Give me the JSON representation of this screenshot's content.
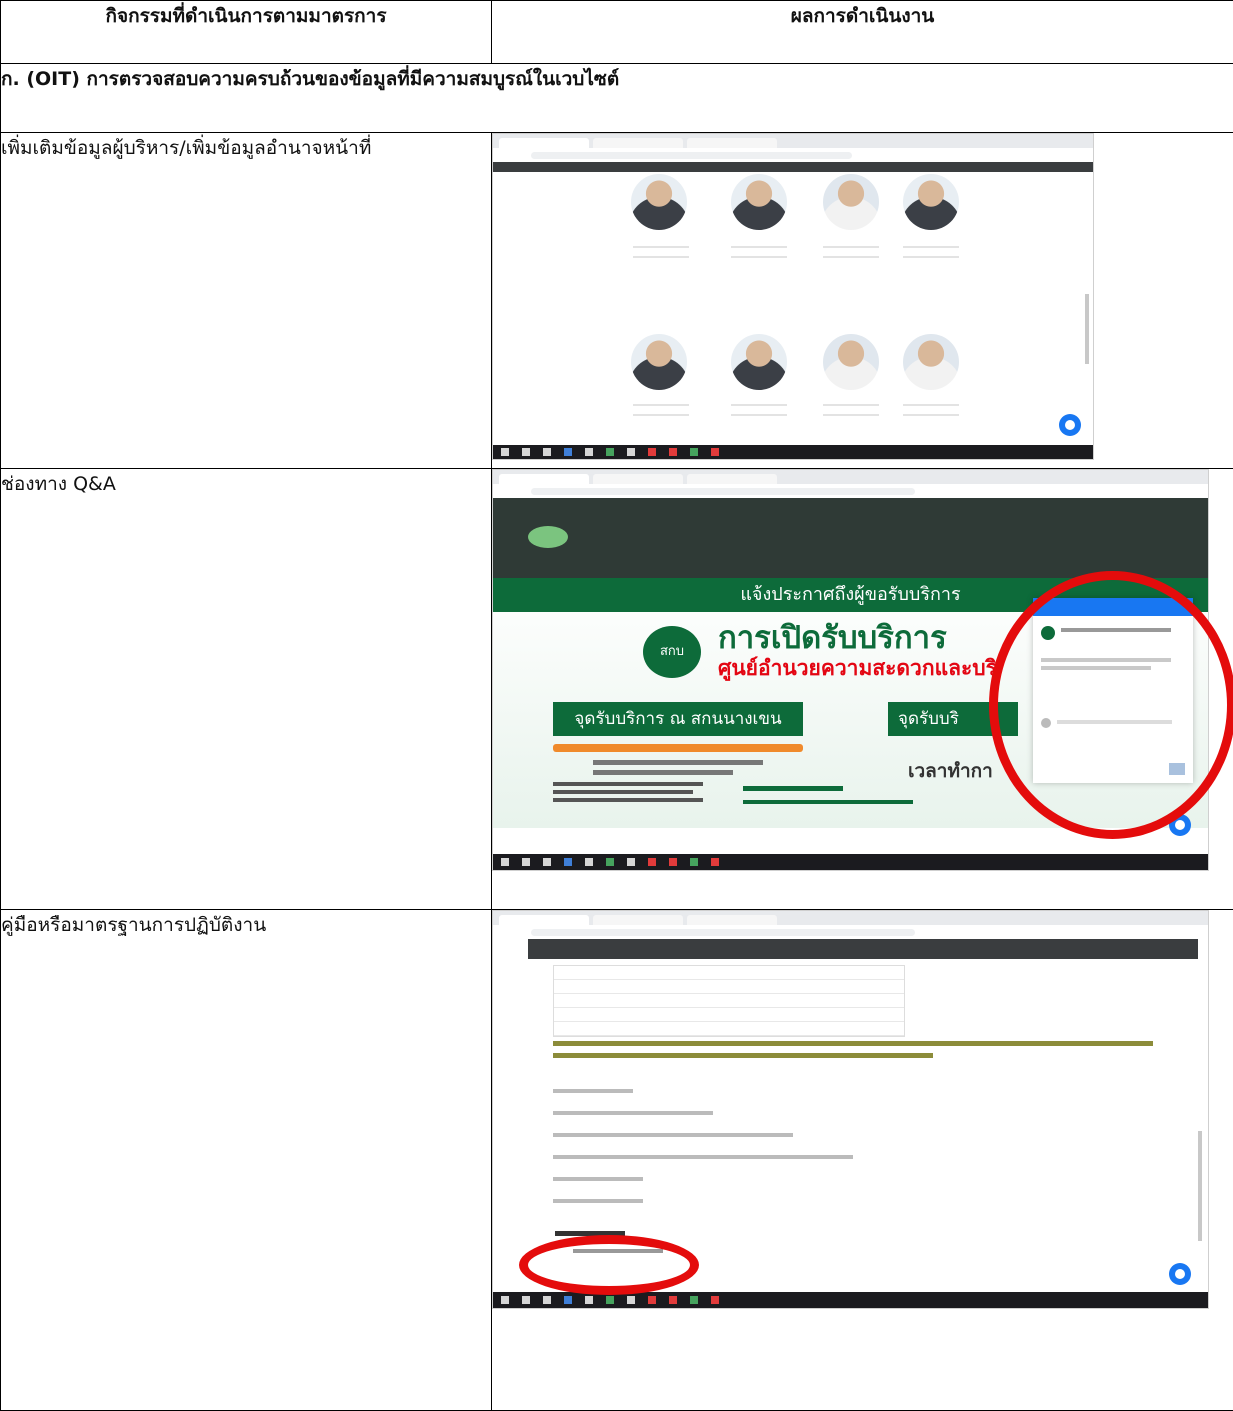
{
  "header": {
    "col1": "กิจกรรมที่ดำเนินการตามมาตรการ",
    "col2": "ผลการดำเนินงาน"
  },
  "section": {
    "title": "ก.  (OIT) การตรวจสอบความครบถ้วนของข้อมูลที่มีความสมบูรณ์ในเวบไซต์"
  },
  "rows": [
    {
      "label": "เพิ่มเติมข้อมูลผู้บริหาร/เพิ่มข้อมูลอำนาจหน้าที่"
    },
    {
      "label": "ช่องทาง Q&A"
    },
    {
      "label": "คู่มือหรือมาตรฐานการปฏิบัติงาน"
    }
  ],
  "shot2": {
    "banner_heading": "แจ้งประกาศถึงผู้ขอรับบริการ",
    "banner_title": "การเปิดรับบริการ",
    "banner_sub": "ศูนย์อำนวยความสะดวกและบริ",
    "logo_text": "สกบ",
    "point1": "จุดรับบริการ ณ สกนนางเขน",
    "point2": "จุดรับบริ",
    "time": "เวลาทำกา",
    "colors": {
      "green": "#0d6b3a",
      "accent": "#e30613",
      "messenger": "#1877f2"
    }
  }
}
